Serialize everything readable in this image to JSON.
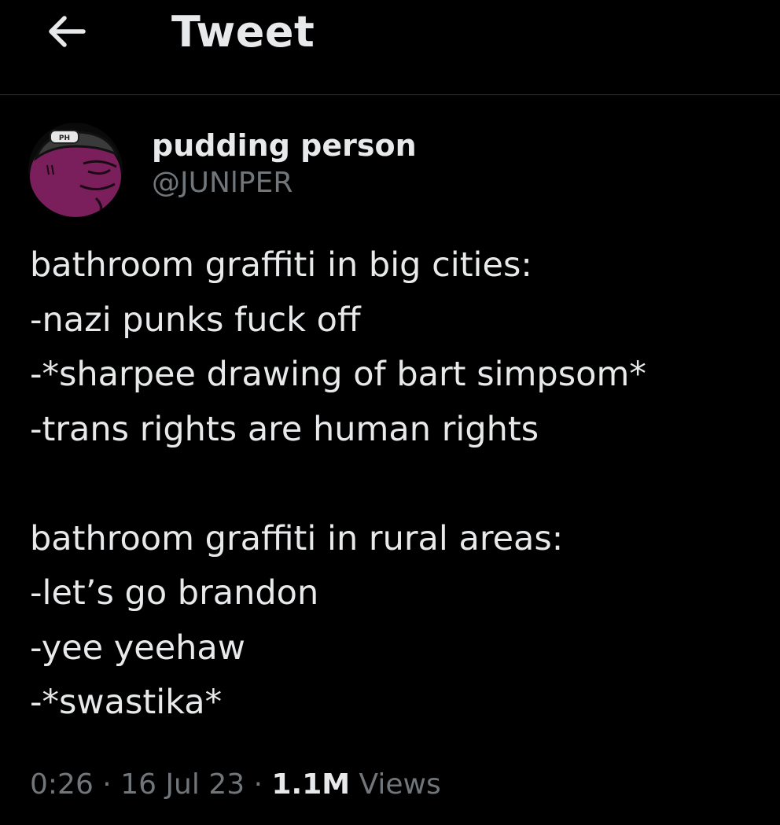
{
  "header": {
    "title": "Tweet",
    "back_icon": "arrow-left-icon"
  },
  "author": {
    "display_name": "pudding person",
    "handle": "@JUNlPER",
    "avatar_icon": "avatar",
    "avatar_colors": {
      "face": "#7a1e5c",
      "hat": "#3a3a3a"
    }
  },
  "tweet": {
    "lines": [
      "bathroom graffiti in big cities:",
      "-nazi punks fuck off",
      "-*sharpee drawing of bart simpsom*",
      "-trans rights are human rights",
      "",
      "bathroom graffiti in rural areas:",
      "-let’s go brandon",
      "-yee yeehaw",
      "-*swastika*"
    ]
  },
  "meta": {
    "time": "0:26",
    "separator": " · ",
    "date": "16 Jul 23",
    "views_count": "1.1M",
    "views_label": " Views"
  },
  "colors": {
    "background": "#000000",
    "text": "#e7e9ea",
    "secondary": "#71767b",
    "divider": "#2f3336"
  }
}
